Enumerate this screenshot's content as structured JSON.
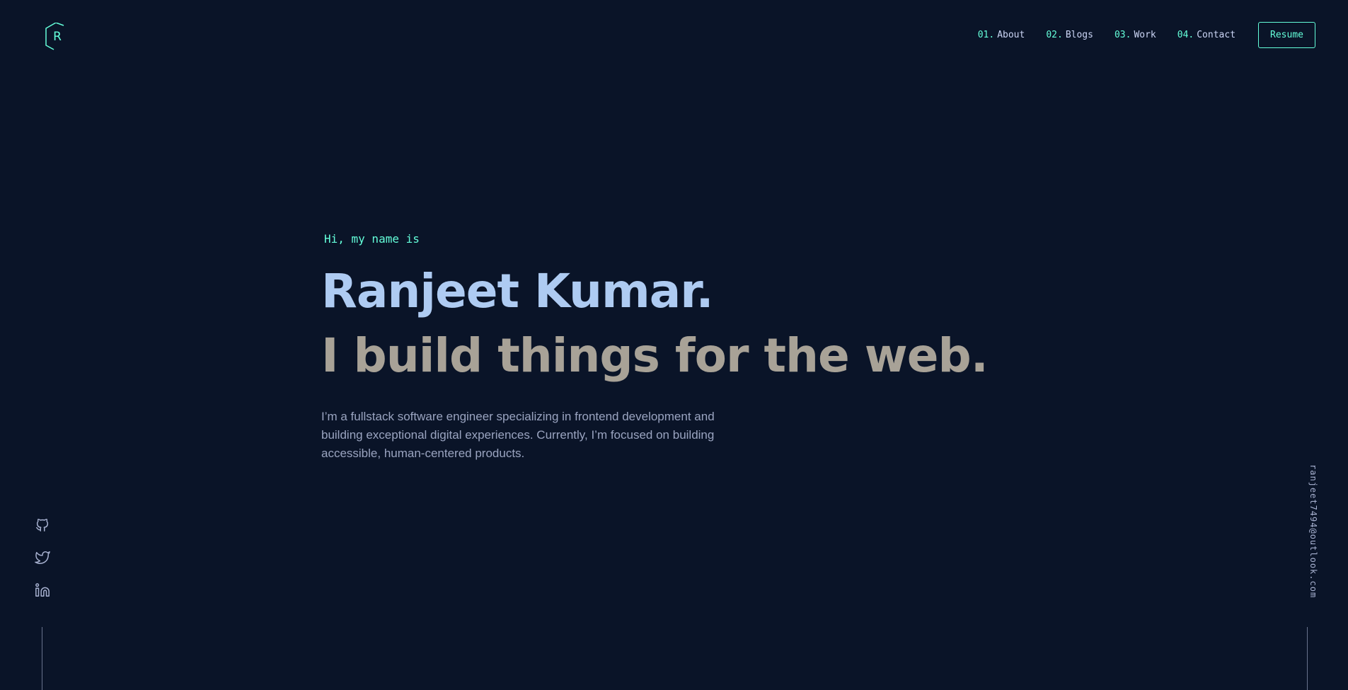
{
  "logo": {
    "letter": "R"
  },
  "nav": {
    "items": [
      {
        "number": "01.",
        "label": "About"
      },
      {
        "number": "02.",
        "label": "Blogs"
      },
      {
        "number": "03.",
        "label": "Work"
      },
      {
        "number": "04.",
        "label": "Contact"
      }
    ],
    "resume_label": "Resume"
  },
  "hero": {
    "intro": "Hi, my name is",
    "name": "Ranjeet Kumar.",
    "tagline": "I build things for the web.",
    "description": "I’m a fullstack software engineer specializing in frontend development and building exceptional digital experiences. Currently, I’m focused on building accessible, human-centered products."
  },
  "social": {
    "icons": [
      "github-icon",
      "twitter-icon",
      "linkedin-icon"
    ]
  },
  "email": {
    "address": "ranjeet7494@outlook.com"
  },
  "colors": {
    "background": "#0a1428",
    "accent": "#64ffda",
    "name": "#aecbf2",
    "tagline": "#a8a297",
    "text": "#a8b2d1"
  }
}
